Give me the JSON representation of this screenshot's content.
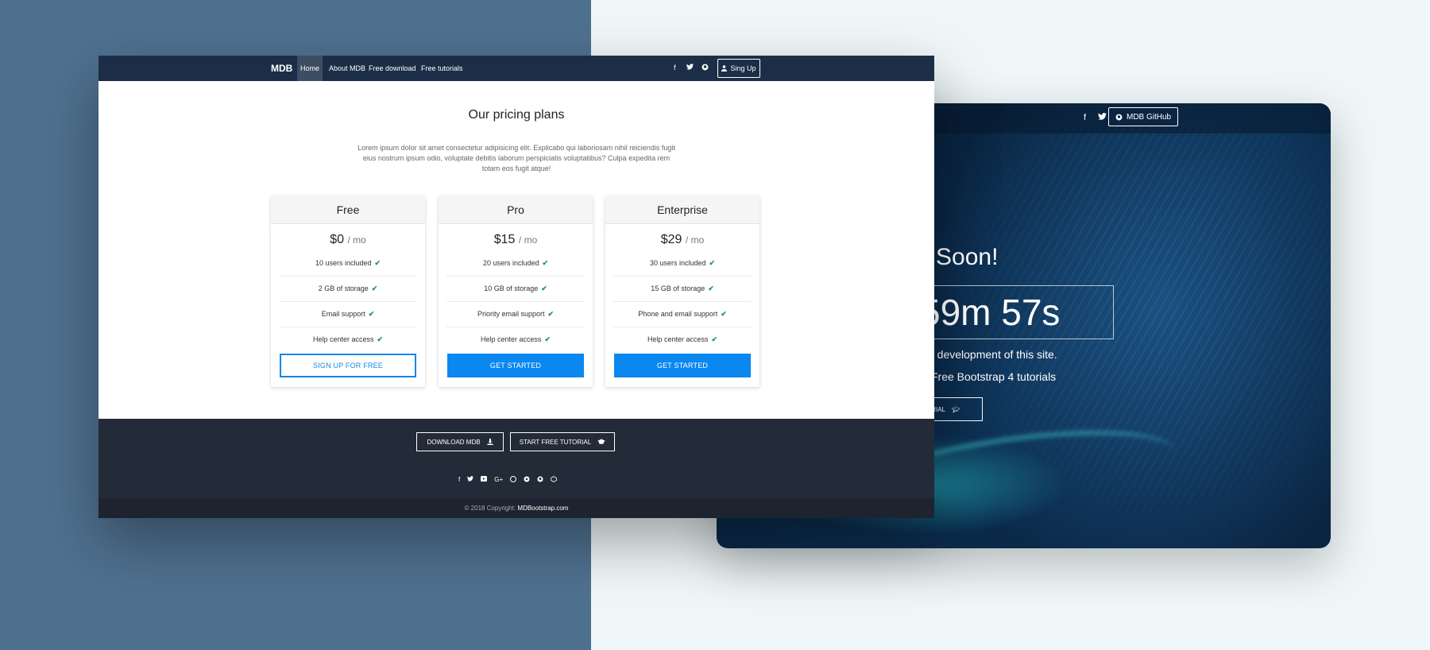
{
  "back_window": {
    "nav": {
      "facebook_icon": "f",
      "twitter_icon": "twitter",
      "github_button": "MDB GitHub"
    },
    "title": "Soon!",
    "countdown": "59m 57s",
    "line1": "e development of this site.",
    "line2": "Free Bootstrap 4 tutorials",
    "button_label": "ORIAL"
  },
  "front_window": {
    "nav": {
      "brand": "MDB",
      "links": [
        "Home",
        "About MDB",
        "Free download",
        "Free tutorials"
      ],
      "active_link": "Home",
      "signup_label": "Sing Up"
    },
    "heading": "Our pricing plans",
    "intro": "Lorem ipsum dolor sit amet consectetur adipisicing elit. Explicabo qui laboriosam nihil reiciendis fugit eius nostrum ipsum odio, voluptate debitis laborum perspiciatis voluptatibus? Culpa expedita rem totam eos fugit atque!",
    "plans": [
      {
        "name": "Free",
        "price": "$0",
        "period": "/ mo",
        "features": [
          "10 users included",
          "2 GB of storage",
          "Email support",
          "Help center access"
        ],
        "button": "SIGN UP FOR FREE",
        "button_style": "outline"
      },
      {
        "name": "Pro",
        "price": "$15",
        "period": "/ mo",
        "features": [
          "20 users included",
          "10 GB of storage",
          "Priority email support",
          "Help center access"
        ],
        "button": "GET STARTED",
        "button_style": "solid"
      },
      {
        "name": "Enterprise",
        "price": "$29",
        "period": "/ mo",
        "features": [
          "30 users included",
          "15 GB of storage",
          "Phone and email support",
          "Help center access"
        ],
        "button": "GET STARTED",
        "button_style": "solid"
      }
    ],
    "footer": {
      "download_button": "DOWNLOAD MDB",
      "tutorial_button": "START FREE TUTORIAL",
      "social_icons": [
        "facebook-icon",
        "twitter-icon",
        "youtube-icon",
        "google-plus-icon",
        "dribbble-icon",
        "pinterest-icon",
        "github-icon",
        "codepen-icon"
      ],
      "copyright_prefix": "© 2018 Copyright:",
      "copyright_link": "MDBootstrap.com"
    }
  },
  "colors": {
    "left_background": "#4f7190",
    "right_background": "#eff7f9",
    "navbar": "#1c2e47",
    "primary": "#0b87f0",
    "check": "#1f9c43",
    "footer": "#232b38"
  }
}
